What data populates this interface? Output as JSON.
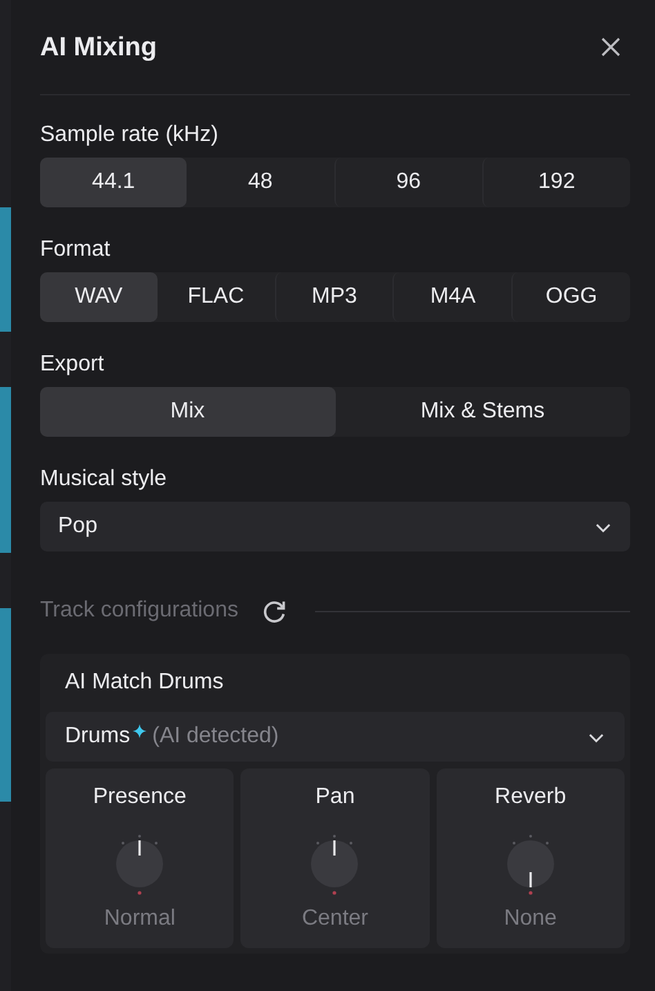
{
  "panel": {
    "title": "AI Mixing"
  },
  "sections": [
    {
      "kind": "segmented",
      "label": "Sample rate (kHz)",
      "options": [
        {
          "label": "44.1",
          "selected": true
        },
        {
          "label": "48",
          "selected": false
        },
        {
          "label": "96",
          "selected": false
        },
        {
          "label": "192",
          "selected": false
        }
      ]
    },
    {
      "kind": "segmented",
      "label": "Format",
      "options": [
        {
          "label": "WAV",
          "selected": true
        },
        {
          "label": "FLAC",
          "selected": false
        },
        {
          "label": "MP3",
          "selected": false
        },
        {
          "label": "M4A",
          "selected": false
        },
        {
          "label": "OGG",
          "selected": false
        }
      ]
    },
    {
      "kind": "segmented",
      "label": "Export",
      "options": [
        {
          "label": "Mix",
          "selected": true
        },
        {
          "label": "Mix & Stems",
          "selected": false
        }
      ]
    },
    {
      "kind": "dropdown",
      "label": "Musical style",
      "value": "Pop"
    }
  ],
  "track_configurations": {
    "label": "Track configurations",
    "card": {
      "title": "AI Match Drums",
      "instrument": {
        "value": "Drums",
        "note": "(AI detected)"
      },
      "knobs": [
        {
          "label": "Presence",
          "at_minimum": false,
          "reading": "Normal"
        },
        {
          "label": "Pan",
          "at_minimum": false,
          "reading": "Center"
        },
        {
          "label": "Reverb",
          "at_minimum": true,
          "reading": "None"
        }
      ]
    }
  }
}
